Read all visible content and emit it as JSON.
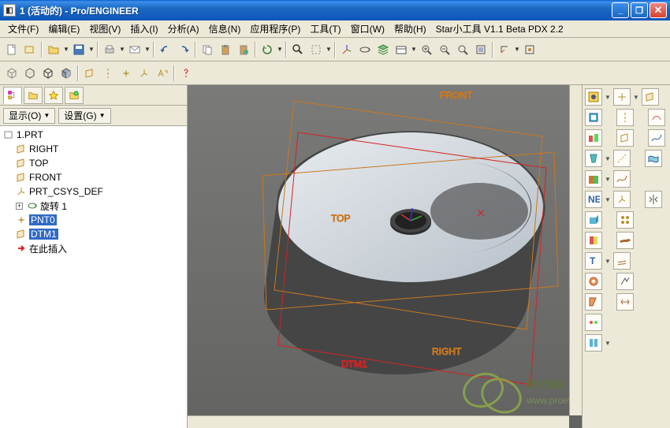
{
  "window": {
    "title": "1 (活动的) - Pro/ENGINEER"
  },
  "menu": {
    "file": "文件(F)",
    "edit": "编辑(E)",
    "view": "视图(V)",
    "insert": "插入(I)",
    "analysis": "分析(A)",
    "info": "信息(N)",
    "app": "应用程序(P)",
    "tools": "工具(T)",
    "window": "窗口(W)",
    "help": "帮助(H)",
    "extra": "Star小工具 V1.1 Beta  PDX 2.2"
  },
  "leftpanel": {
    "show_btn": "显示(O)",
    "settings_btn": "设置(G)"
  },
  "tree": {
    "root": "1.PRT",
    "right": "RIGHT",
    "top": "TOP",
    "front": "FRONT",
    "csys": "PRT_CSYS_DEF",
    "revolve": "旋转 1",
    "pnt0": "PNT0",
    "dtm1": "DTM1",
    "insert_here": "在此插入"
  },
  "datums": {
    "front": "FRONT",
    "top": "TOP",
    "right": "RIGHT",
    "dtm1": "DTM1"
  },
  "watermark": {
    "text": "野火论坛",
    "url": "www.proewildfire.cn"
  }
}
